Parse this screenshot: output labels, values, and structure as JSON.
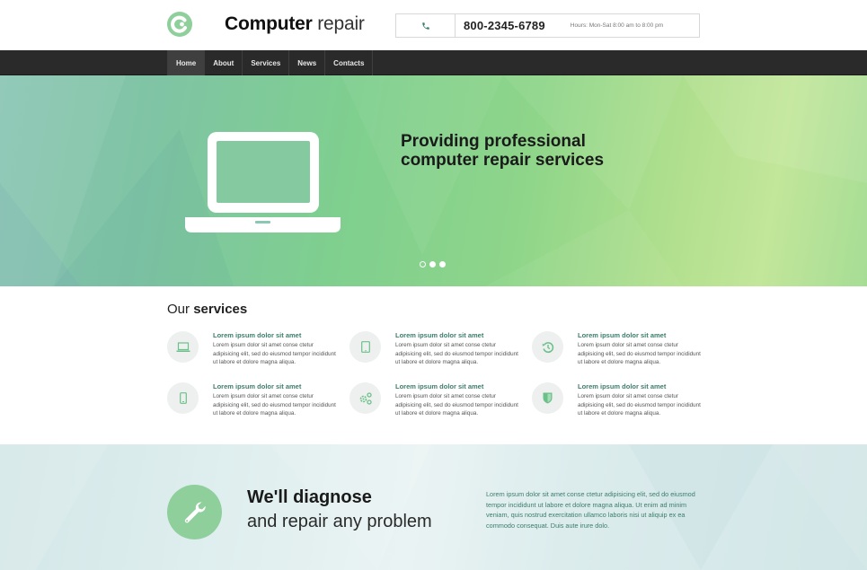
{
  "header": {
    "logo_icon": "refresh-c-logo-icon",
    "brand_bold": "Computer",
    "brand_light": "repair",
    "phone_icon": "phone-icon",
    "phone_number": "800-2345-6789",
    "hours": "Hours: Mon-Sat 8:00 am to 8:00 pm"
  },
  "nav": {
    "items": [
      {
        "label": "Home",
        "active": true
      },
      {
        "label": "About",
        "active": false
      },
      {
        "label": "Services",
        "active": false
      },
      {
        "label": "News",
        "active": false
      },
      {
        "label": "Contacts",
        "active": false
      }
    ]
  },
  "hero": {
    "icon": "laptop-icon",
    "title_line1": "Providing professional",
    "title_line2": "computer repair services",
    "slides": 3,
    "active_slide": 1
  },
  "services": {
    "heading_light": "Our",
    "heading_bold": "services",
    "accent_color": "#3c7d6b",
    "icon_color": "#6cc08a",
    "items": [
      {
        "icon": "laptop-icon",
        "title": "Lorem ipsum dolor sit amet",
        "text": "Lorem ipsum dolor sit amet conse ctetur adipisicing elit, sed do eiusmod tempor incididunt ut labore et dolore magna aliqua."
      },
      {
        "icon": "tablet-icon",
        "title": "Lorem ipsum dolor sit amet",
        "text": "Lorem ipsum dolor sit amet conse ctetur adipisicing elit, sed do eiusmod tempor incididunt ut labore et dolore magna aliqua."
      },
      {
        "icon": "history-icon",
        "title": "Lorem ipsum dolor sit amet",
        "text": "Lorem ipsum dolor sit amet conse ctetur adipisicing elit, sed do eiusmod tempor incididunt ut labore et dolore magna aliqua."
      },
      {
        "icon": "smartphone-icon",
        "title": "Lorem ipsum dolor sit amet",
        "text": "Lorem ipsum dolor sit amet conse ctetur adipisicing elit, sed do eiusmod tempor incididunt ut labore et dolore magna aliqua."
      },
      {
        "icon": "gears-icon",
        "title": "Lorem ipsum dolor sit amet",
        "text": "Lorem ipsum dolor sit amet conse ctetur adipisicing elit, sed do eiusmod tempor incididunt ut labore et dolore magna aliqua."
      },
      {
        "icon": "shield-icon",
        "title": "Lorem ipsum dolor sit amet",
        "text": "Lorem ipsum dolor sit amet conse ctetur adipisicing elit, sed do eiusmod tempor incididunt ut labore et dolore magna aliqua."
      }
    ]
  },
  "diagnose": {
    "icon": "wrench-icon",
    "title": "We'll diagnose",
    "subtitle": "and repair any problem",
    "text": "Lorem ipsum dolor sit amet conse ctetur adipisicing elit, sed do eiusmod tempor incididunt ut labore et dolore magna aliqua. Ut enim ad minim veniam, quis nostrud exercitation ullamco laboris nisi ut aliquip ex ea commodo consequat. Duis aute irure dolo."
  }
}
